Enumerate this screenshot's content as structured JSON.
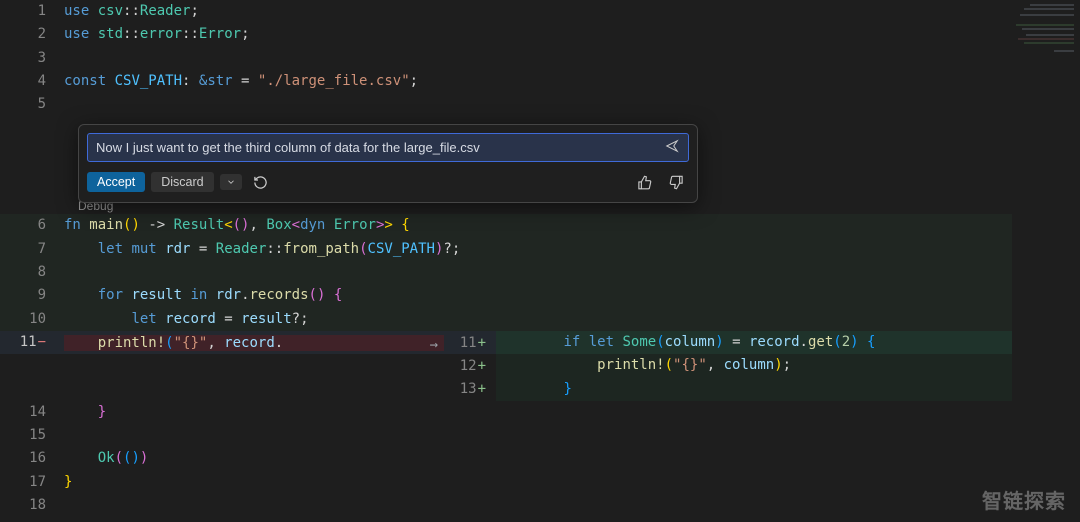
{
  "chat": {
    "input_text": "Now I just want to get the third column of data for the large_file.csv",
    "accept": "Accept",
    "discard": "Discard"
  },
  "codelens": {
    "debug": "Debug"
  },
  "lines": {
    "l1_use": "use",
    "l1_csv": "csv",
    "l1_reader": "Reader",
    "l2_use": "use",
    "l2_std": "std",
    "l2_error_mod": "error",
    "l2_error_ty": "Error",
    "l4_const": "const",
    "l4_name": "CSV_PATH",
    "l4_ty": "&str",
    "l4_val": "\"./large_file.csv\"",
    "l6_fn": "fn",
    "l6_main": "main",
    "l6_result": "Result",
    "l6_box": "Box",
    "l6_dyn": "dyn",
    "l6_err": "Error",
    "l7_let": "let",
    "l7_mut": "mut",
    "l7_rdr": "rdr",
    "l7_reader": "Reader",
    "l7_from_path": "from_path",
    "l7_csvpath": "CSV_PATH",
    "l9_for": "for",
    "l9_result": "result",
    "l9_in": "in",
    "l9_rdr": "rdr",
    "l9_records": "records",
    "l10_let": "let",
    "l10_record": "record",
    "l10_result": "result",
    "l11_println": "println!",
    "l11_fmt": "\"{}\"",
    "l11_record": "record",
    "r11_if": "if",
    "r11_let": "let",
    "r11_some": "Some",
    "r11_col": "column",
    "r11_record": "record",
    "r11_get": "get",
    "r11_idx": "2",
    "r12_println": "println!",
    "r12_fmt": "\"{}\"",
    "r12_col": "column",
    "l16_ok": "Ok"
  },
  "gutter": {
    "1": "1",
    "2": "2",
    "3": "3",
    "4": "4",
    "5": "5",
    "6": "6",
    "7": "7",
    "8": "8",
    "9": "9",
    "10": "10",
    "11": "11",
    "12": "12",
    "13": "13",
    "14": "14",
    "15": "15",
    "16": "16",
    "17": "17",
    "18": "18",
    "r11": "11",
    "r12": "12",
    "r13": "13"
  },
  "watermark": "智链探索"
}
